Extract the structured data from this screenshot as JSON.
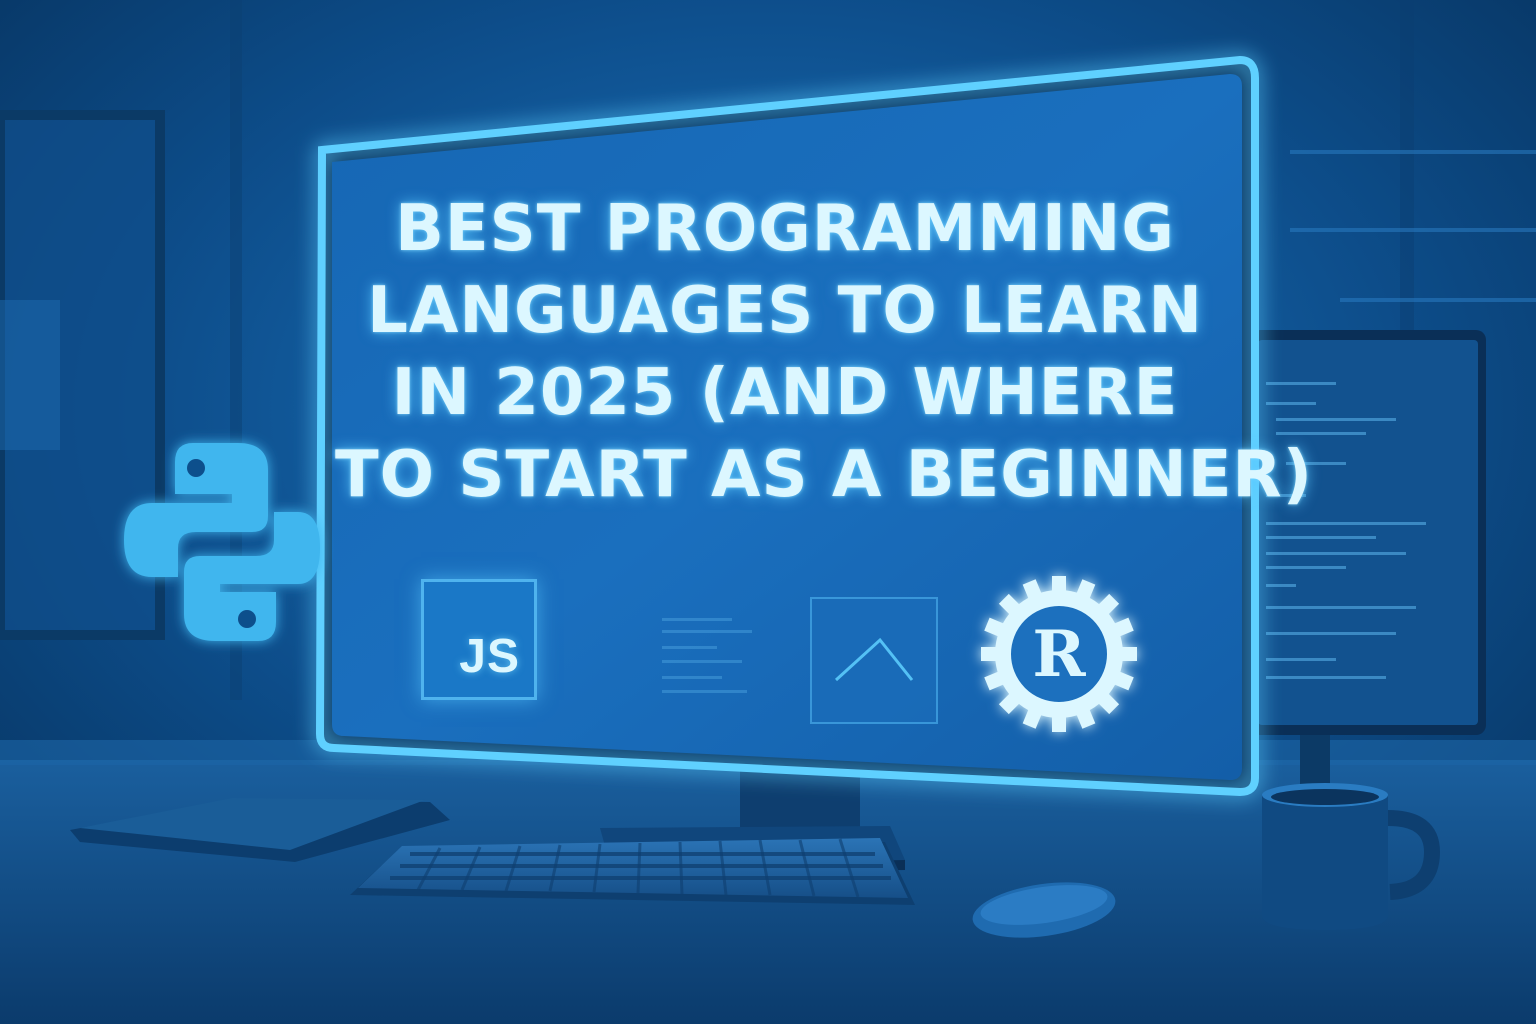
{
  "headline": {
    "line1": "BEST PROGRAMMING",
    "line2": "LANGUAGES TO LEARN",
    "line3": "IN 2025 (AND WHERE",
    "line4": "TO START AS A BEGINNER)"
  },
  "badges": {
    "javascript": "JS",
    "rust": "R"
  },
  "icons": [
    "python-logo-icon",
    "javascript-logo-icon",
    "code-snippet-icon",
    "chart-line-icon",
    "rust-logo-icon"
  ],
  "colors": {
    "background": "#0a3f72",
    "monitor_glow": "#5fd0ff",
    "headline_text": "#dcf7ff",
    "js_badge": "#1a78c7",
    "python_logo": "#3fb6ee"
  }
}
